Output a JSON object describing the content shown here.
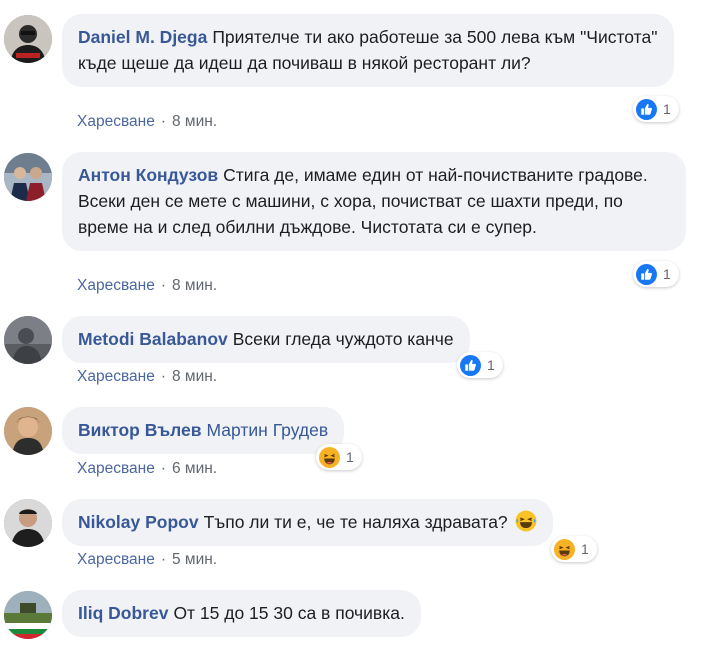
{
  "comments": [
    {
      "author": "Daniel M. Djega",
      "text": "Приятелче ти ако работеше за 500 лева към \"Чистота\" къде щеше да идеш да почиваш в някой ресторант ли?",
      "like_label": "Харесване",
      "separator": "·",
      "time": "8 мин.",
      "reaction_icon": "like-icon",
      "reaction_count": "1"
    },
    {
      "author": "Антон Кондузов",
      "text": "Стига де, имаме един от най-почистваните градове. Всеки ден се мете с машини, с хора, почистват се шахти преди, по време на и след обилни дъждове. Чистотата си е супер.",
      "like_label": "Харесване",
      "separator": "·",
      "time": "8 мин.",
      "reaction_icon": "like-icon",
      "reaction_count": "1"
    },
    {
      "author": "Metodi Balabanov",
      "text": "Всеки гледа чуждото канче",
      "like_label": "Харесване",
      "separator": "·",
      "time": "8 мин.",
      "reaction_icon": "like-icon",
      "reaction_count": "1"
    },
    {
      "author": "Виктор Вълев",
      "tag": "Мартин Грудев",
      "text": "",
      "like_label": "Харесване",
      "separator": "·",
      "time": "6 мин.",
      "reaction_icon": "haha-icon",
      "reaction_count": "1"
    },
    {
      "author": "Nikolay Popov",
      "text": "Тъпо ли ти е, че те наляха здравата?",
      "inline_emoji": "laughing-emoji",
      "like_label": "Харесване",
      "separator": "·",
      "time": "5 мин.",
      "reaction_icon": "haha-icon",
      "reaction_count": "1"
    },
    {
      "author": "Iliq Dobrev",
      "text": "От 15 до 15 30 са в почивка."
    }
  ],
  "colors": {
    "author": "#385898",
    "bubble_bg": "#f0f2f5",
    "like_blue": "#1877f2",
    "meta_gray": "#606770"
  }
}
